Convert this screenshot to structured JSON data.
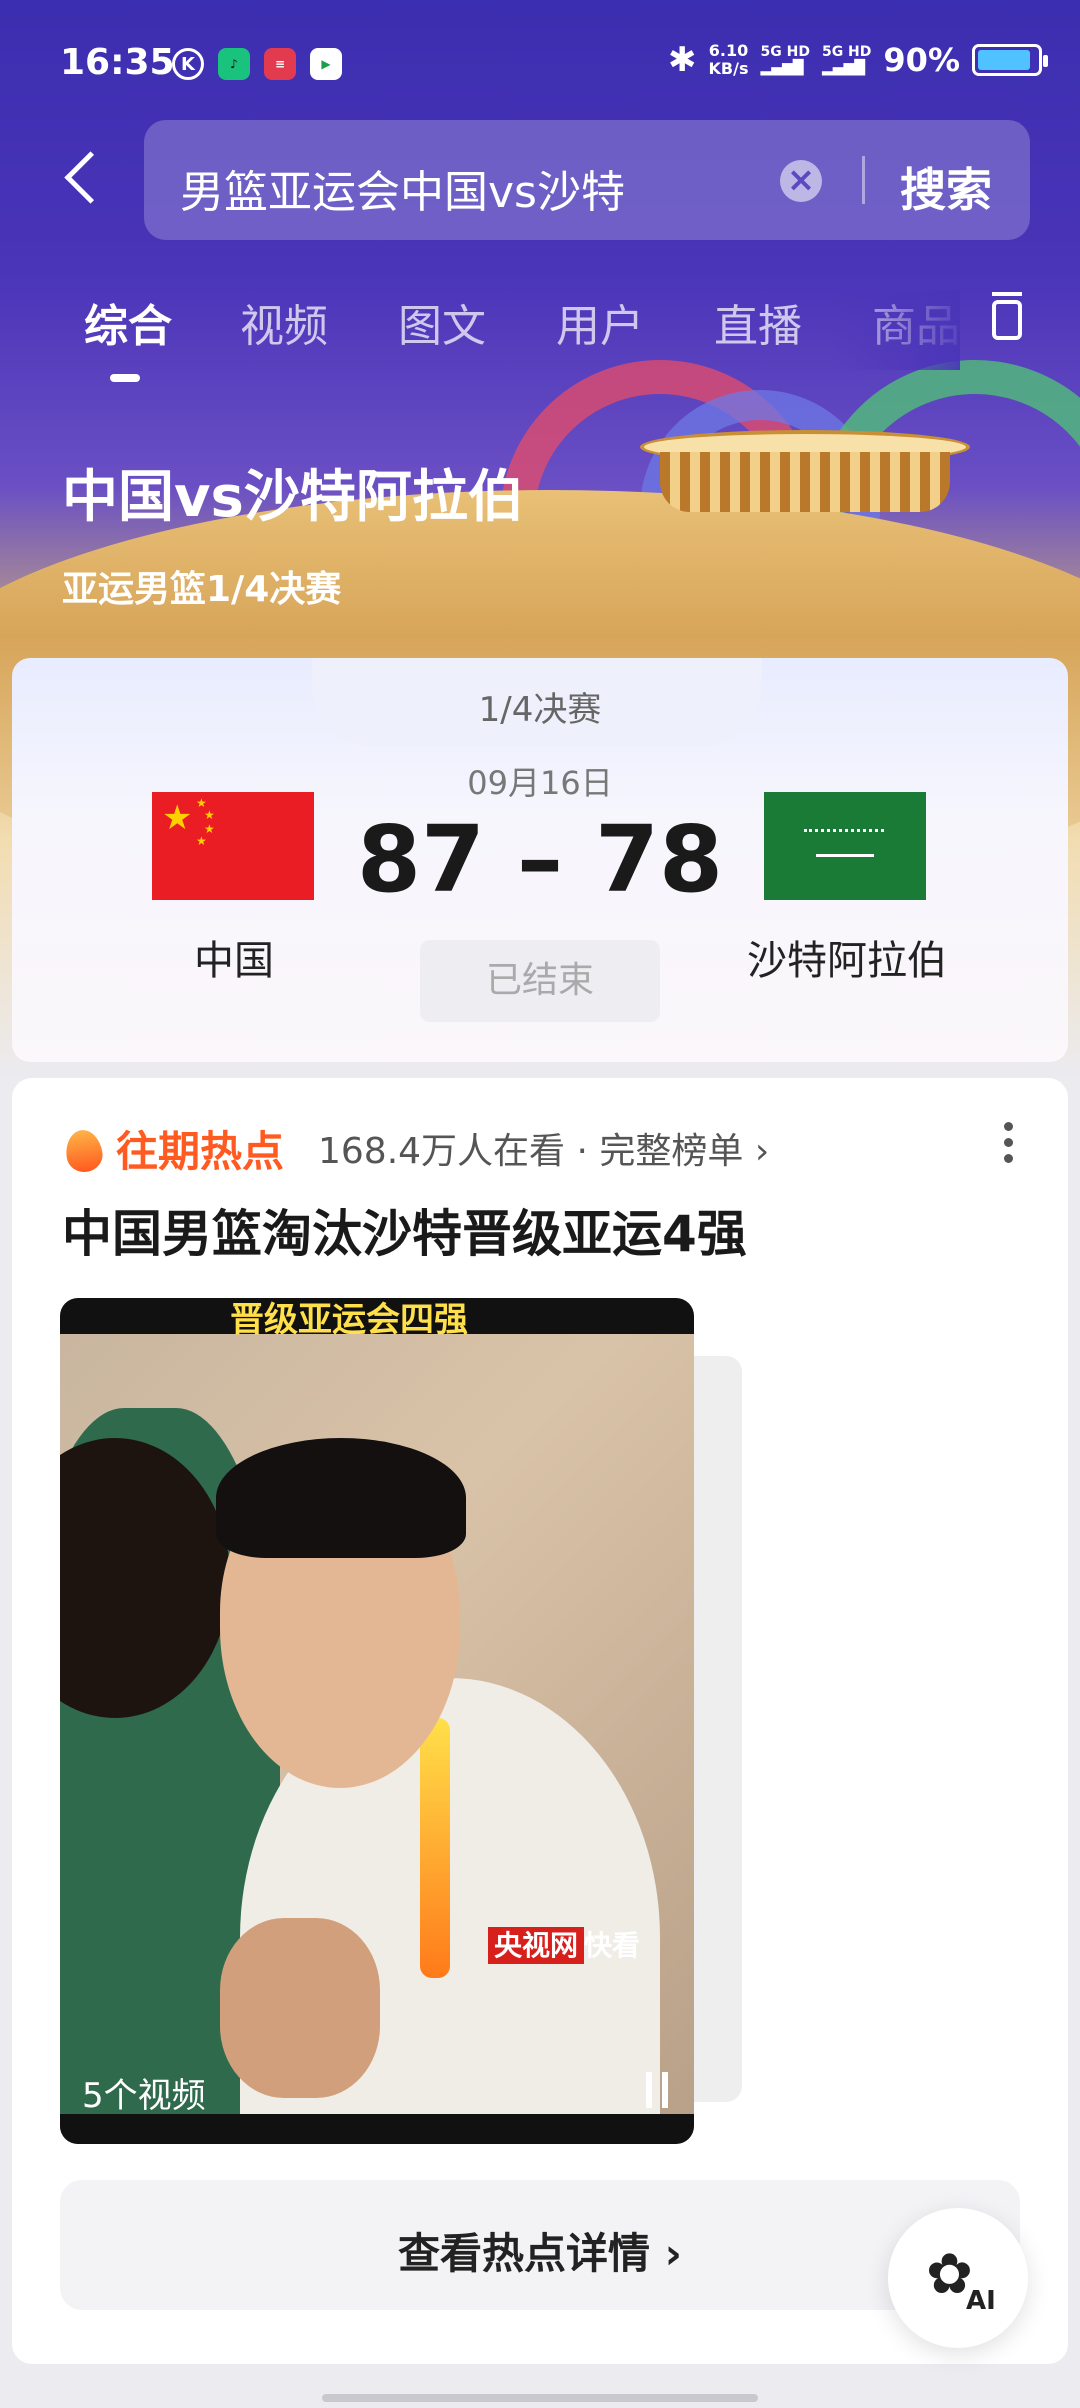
{
  "status_bar": {
    "time": "16:35",
    "app_icons": [
      "k-icon",
      "music-icon",
      "news-icon",
      "ticket-icon"
    ],
    "net_speed": "6.10",
    "net_unit": "KB/s",
    "sim1": "5G HD",
    "sim2": "5G HD",
    "battery_pct": "90%",
    "battery_level": 0.9
  },
  "search": {
    "query": "男篮亚运会中国vs沙特",
    "button": "搜索"
  },
  "tabs": [
    "综合",
    "视频",
    "图文",
    "用户",
    "直播",
    "商品"
  ],
  "hero": {
    "title": "中国vs沙特阿拉伯",
    "subtitle": "亚运男篮1/4决赛"
  },
  "match": {
    "round": "1/4决赛",
    "date": "09月16日",
    "home_team": "中国",
    "away_team": "沙特阿拉伯",
    "score": "87 – 78",
    "status": "已结束"
  },
  "hot": {
    "label": "往期热点",
    "meta": "168.4万人在看 · 完整榜单 ›",
    "title": "中国男篮淘汰沙特晋级亚运4强",
    "video_caption": "晋级亚运会四强",
    "video_source_1": "央视网",
    "video_source_2": "快看",
    "video_count": "5个视频",
    "detail_button": "查看热点详情 ›"
  },
  "ai_fab": {
    "label": "AI"
  },
  "colors": {
    "header_purple": "#4a34b8",
    "hot_orange": "#ff5a1f",
    "china_red": "#ea1c24",
    "saudi_green": "#1a7b36"
  }
}
